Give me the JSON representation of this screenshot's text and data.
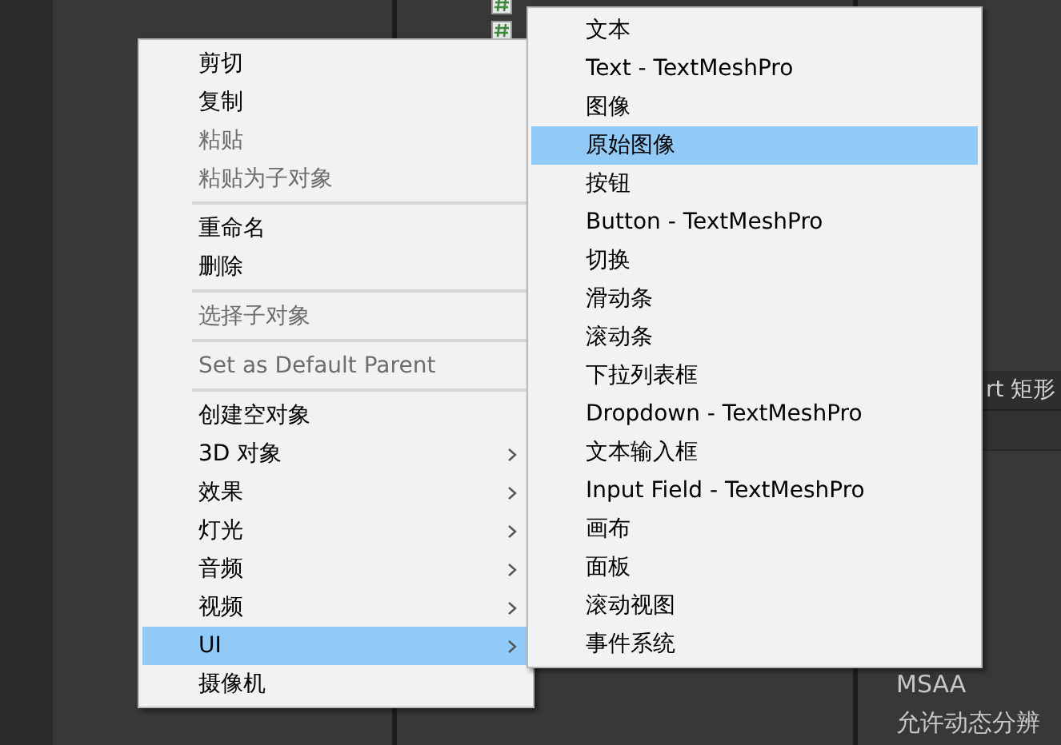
{
  "inspector": {
    "header": "rt 矩形",
    "fields": [
      "MSAA",
      "允许动态分辨"
    ]
  },
  "context_menu": {
    "items": [
      {
        "kind": "item",
        "label": "剪切",
        "disabled": false,
        "has_submenu": false,
        "selected": false
      },
      {
        "kind": "item",
        "label": "复制",
        "disabled": false,
        "has_submenu": false,
        "selected": false
      },
      {
        "kind": "item",
        "label": "粘贴",
        "disabled": true,
        "has_submenu": false,
        "selected": false
      },
      {
        "kind": "item",
        "label": "粘贴为子对象",
        "disabled": true,
        "has_submenu": false,
        "selected": false
      },
      {
        "kind": "separator"
      },
      {
        "kind": "item",
        "label": "重命名",
        "disabled": false,
        "has_submenu": false,
        "selected": false
      },
      {
        "kind": "item",
        "label": "删除",
        "disabled": false,
        "has_submenu": false,
        "selected": false
      },
      {
        "kind": "separator"
      },
      {
        "kind": "item",
        "label": "选择子对象",
        "disabled": true,
        "has_submenu": false,
        "selected": false
      },
      {
        "kind": "separator"
      },
      {
        "kind": "item",
        "label": "Set as Default Parent",
        "disabled": true,
        "has_submenu": false,
        "selected": false
      },
      {
        "kind": "separator"
      },
      {
        "kind": "item",
        "label": "创建空对象",
        "disabled": false,
        "has_submenu": false,
        "selected": false
      },
      {
        "kind": "item",
        "label": "3D 对象",
        "disabled": false,
        "has_submenu": true,
        "selected": false
      },
      {
        "kind": "item",
        "label": "效果",
        "disabled": false,
        "has_submenu": true,
        "selected": false
      },
      {
        "kind": "item",
        "label": "灯光",
        "disabled": false,
        "has_submenu": true,
        "selected": false
      },
      {
        "kind": "item",
        "label": "音频",
        "disabled": false,
        "has_submenu": true,
        "selected": false
      },
      {
        "kind": "item",
        "label": "视频",
        "disabled": false,
        "has_submenu": true,
        "selected": false
      },
      {
        "kind": "item",
        "label": "UI",
        "disabled": false,
        "has_submenu": true,
        "selected": true
      },
      {
        "kind": "item",
        "label": "摄像机",
        "disabled": false,
        "has_submenu": false,
        "selected": false
      }
    ]
  },
  "submenu": {
    "items": [
      {
        "kind": "item",
        "label": "文本",
        "selected": false
      },
      {
        "kind": "item",
        "label": "Text - TextMeshPro",
        "selected": false
      },
      {
        "kind": "item",
        "label": "图像",
        "selected": false
      },
      {
        "kind": "item",
        "label": "原始图像",
        "selected": true
      },
      {
        "kind": "item",
        "label": "按钮",
        "selected": false
      },
      {
        "kind": "item",
        "label": "Button - TextMeshPro",
        "selected": false
      },
      {
        "kind": "item",
        "label": "切换",
        "selected": false
      },
      {
        "kind": "item",
        "label": "滑动条",
        "selected": false
      },
      {
        "kind": "item",
        "label": "滚动条",
        "selected": false
      },
      {
        "kind": "item",
        "label": "下拉列表框",
        "selected": false
      },
      {
        "kind": "item",
        "label": "Dropdown - TextMeshPro",
        "selected": false
      },
      {
        "kind": "item",
        "label": "文本输入框",
        "selected": false
      },
      {
        "kind": "item",
        "label": "Input Field - TextMeshPro",
        "selected": false
      },
      {
        "kind": "item",
        "label": "画布",
        "selected": false
      },
      {
        "kind": "item",
        "label": "面板",
        "selected": false
      },
      {
        "kind": "item",
        "label": "滚动视图",
        "selected": false
      },
      {
        "kind": "item",
        "label": "事件系统",
        "selected": false
      }
    ]
  }
}
